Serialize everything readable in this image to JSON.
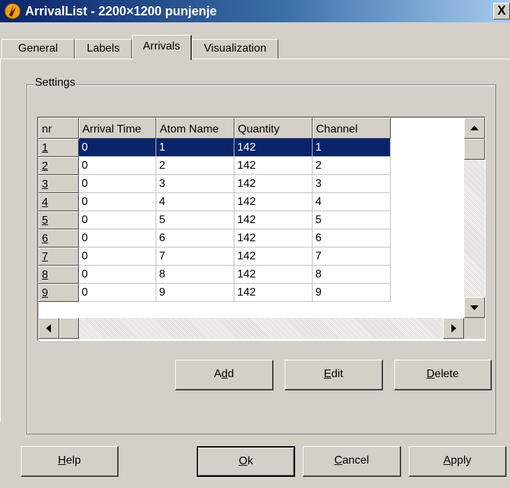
{
  "window": {
    "title": "ArrivalList - 2200×1200 punjenje",
    "close_label": "X"
  },
  "tabs": [
    {
      "label": "General",
      "active": false
    },
    {
      "label": "Labels",
      "active": false
    },
    {
      "label": "Arrivals",
      "active": true
    },
    {
      "label": "Visualization",
      "active": false
    }
  ],
  "settings": {
    "group_label": "Settings"
  },
  "table": {
    "columns": [
      "nr",
      "Arrival Time",
      "Atom Name",
      "Quantity",
      "Channel"
    ],
    "rows": [
      {
        "nr": "1",
        "arrival_time": "0",
        "atom_name": "1",
        "quantity": "142",
        "channel": "1",
        "selected": true
      },
      {
        "nr": "2",
        "arrival_time": "0",
        "atom_name": "2",
        "quantity": "142",
        "channel": "2",
        "selected": false
      },
      {
        "nr": "3",
        "arrival_time": "0",
        "atom_name": "3",
        "quantity": "142",
        "channel": "3",
        "selected": false
      },
      {
        "nr": "4",
        "arrival_time": "0",
        "atom_name": "4",
        "quantity": "142",
        "channel": "4",
        "selected": false
      },
      {
        "nr": "5",
        "arrival_time": "0",
        "atom_name": "5",
        "quantity": "142",
        "channel": "5",
        "selected": false
      },
      {
        "nr": "6",
        "arrival_time": "0",
        "atom_name": "6",
        "quantity": "142",
        "channel": "6",
        "selected": false
      },
      {
        "nr": "7",
        "arrival_time": "0",
        "atom_name": "7",
        "quantity": "142",
        "channel": "7",
        "selected": false
      },
      {
        "nr": "8",
        "arrival_time": "0",
        "atom_name": "8",
        "quantity": "142",
        "channel": "8",
        "selected": false
      },
      {
        "nr": "9",
        "arrival_time": "0",
        "atom_name": "9",
        "quantity": "142",
        "channel": "9",
        "selected": false
      }
    ]
  },
  "actions": {
    "add_pre": "A",
    "add_key": "d",
    "add_post": "d",
    "edit_pre": "",
    "edit_key": "E",
    "edit_post": "dit",
    "delete_pre": "",
    "delete_key": "D",
    "delete_post": "elete"
  },
  "footer": {
    "help_pre": "",
    "help_key": "H",
    "help_post": "elp",
    "ok_pre": "",
    "ok_key": "O",
    "ok_post": "k",
    "cancel_pre": "",
    "cancel_key": "C",
    "cancel_post": "ancel",
    "apply_pre": "",
    "apply_key": "A",
    "apply_post": "pply"
  }
}
